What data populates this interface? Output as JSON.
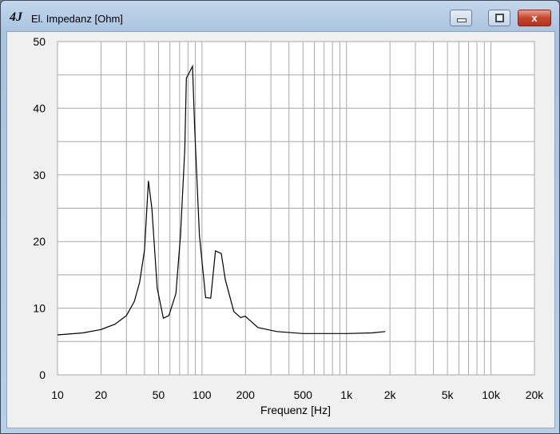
{
  "window": {
    "title": "El. Impedanz [Ohm]",
    "app_icon_text": "4J",
    "close_label": "x"
  },
  "chart_data": {
    "type": "line",
    "title": "El. Impedanz [Ohm]",
    "xlabel": "Frequenz [Hz]",
    "ylabel": "",
    "xscale": "log",
    "xlim": [
      10,
      20000
    ],
    "ylim": [
      0,
      50
    ],
    "grid": true,
    "x_ticks": [
      10,
      20,
      50,
      100,
      200,
      500,
      1000,
      2000,
      5000,
      10000,
      20000
    ],
    "x_tick_labels": [
      "10",
      "20",
      "50",
      "100",
      "200",
      "500",
      "1k",
      "2k",
      "5k",
      "10k",
      "20k"
    ],
    "y_ticks": [
      0,
      10,
      20,
      30,
      40,
      50
    ],
    "y_tick_labels": [
      "0",
      "10",
      "20",
      "30",
      "40",
      "50"
    ],
    "series": [
      {
        "name": "Impedanz",
        "color": "#000000",
        "x": [
          10,
          15,
          20,
          25,
          30,
          34,
          37,
          40,
          42.6,
          45,
          49,
          54,
          59,
          66,
          71,
          76,
          78,
          86,
          89,
          96,
          106,
          115,
          124,
          136,
          145,
          166,
          185,
          199,
          244,
          330,
          500,
          1000,
          1500,
          1860
        ],
        "y": [
          6.0,
          6.3,
          6.8,
          7.6,
          8.9,
          11.0,
          13.9,
          18.7,
          29.1,
          25.0,
          13.0,
          8.5,
          8.9,
          12.2,
          21.0,
          33.8,
          44.5,
          46.3,
          37.0,
          21.0,
          11.6,
          11.5,
          18.6,
          18.2,
          14.3,
          9.5,
          8.6,
          8.8,
          7.1,
          6.5,
          6.2,
          6.2,
          6.3,
          6.5
        ]
      }
    ]
  }
}
